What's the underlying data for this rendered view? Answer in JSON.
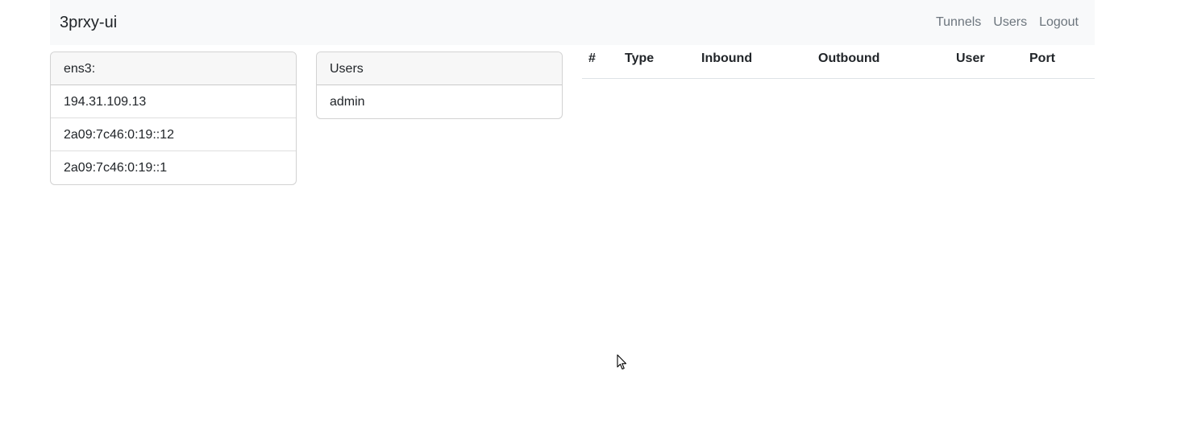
{
  "navbar": {
    "brand": "3prxy-ui",
    "links": [
      "Tunnels",
      "Users",
      "Logout"
    ]
  },
  "interfaces": {
    "header": "ens3:",
    "addresses": [
      "194.31.109.13",
      "2a09:7c46:0:19::12",
      "2a09:7c46:0:19::1"
    ]
  },
  "users": {
    "header": "Users",
    "items": [
      "admin"
    ]
  },
  "tunnels_table": {
    "columns": [
      "#",
      "Type",
      "Inbound",
      "Outbound",
      "User",
      "Port"
    ],
    "rows": []
  }
}
